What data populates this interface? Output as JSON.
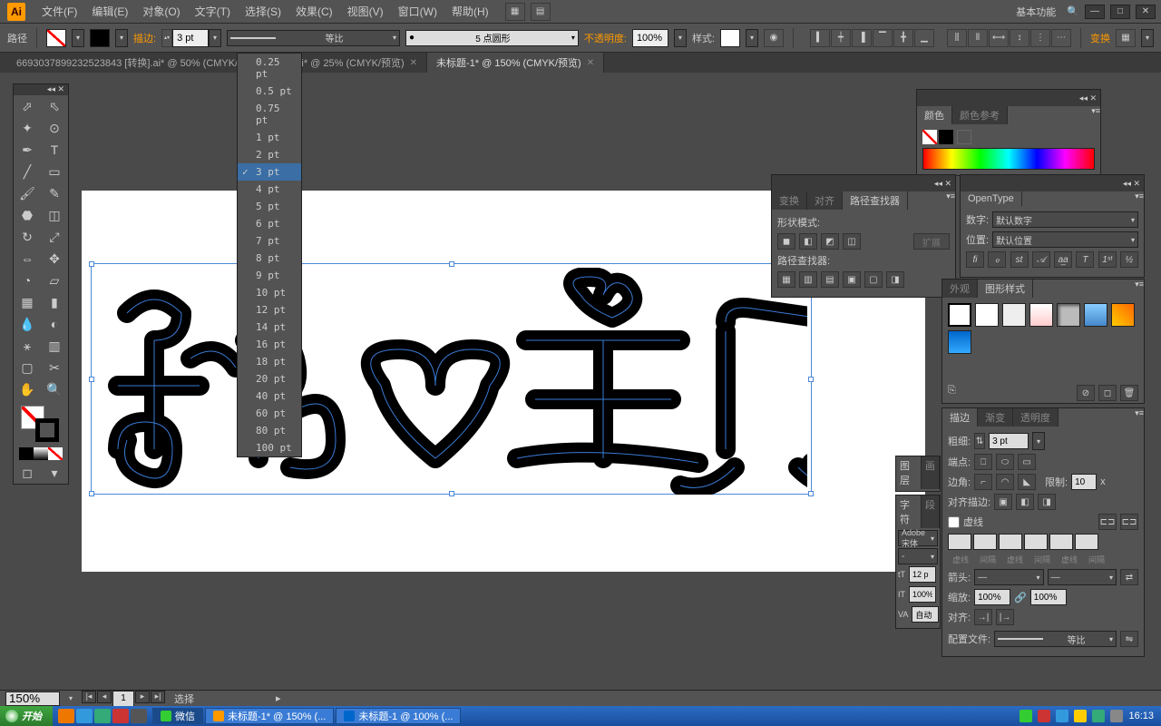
{
  "menubar": {
    "items": [
      "文件(F)",
      "编辑(E)",
      "对象(O)",
      "文字(T)",
      "选择(S)",
      "效果(C)",
      "视图(V)",
      "窗口(W)",
      "帮助(H)"
    ],
    "workspace": "基本功能"
  },
  "control": {
    "object_label": "路径",
    "stroke_label": "描边:",
    "stroke_value": "3 pt",
    "profile": "等比",
    "brush": "5 点圆形",
    "opacity_label": "不透明度:",
    "opacity_value": "100%",
    "style_label": "样式:",
    "transform_label": "变换"
  },
  "tabs": [
    {
      "label": "6693037899232523843 [转换].ai* @ 50% (CMYK/预览)",
      "active": false
    },
    {
      "label": ".ai* @ 25% (CMYK/预览)",
      "active": false
    },
    {
      "label": "未标题-1* @ 150% (CMYK/预览)",
      "active": true
    }
  ],
  "stroke_dropdown": {
    "items": [
      "0.25 pt",
      "0.5 pt",
      "0.75 pt",
      "1 pt",
      "2 pt",
      "3 pt",
      "4 pt",
      "5 pt",
      "6 pt",
      "7 pt",
      "8 pt",
      "9 pt",
      "10 pt",
      "12 pt",
      "14 pt",
      "16 pt",
      "18 pt",
      "20 pt",
      "40 pt",
      "60 pt",
      "80 pt",
      "100 pt"
    ],
    "selected": "3 pt"
  },
  "panels": {
    "color": {
      "tab1": "颜色",
      "tab2": "颜色参考"
    },
    "pathfinder": {
      "tab1": "变换",
      "tab2": "对齐",
      "tab3": "路径查找器",
      "shape_mode": "形状模式:",
      "pathfinder_lbl": "路径查找器:",
      "expand": "扩展"
    },
    "opentype": {
      "tab": "OpenType",
      "digit_lbl": "数字:",
      "digit_val": "默认数字",
      "pos_lbl": "位置:",
      "pos_val": "默认位置"
    },
    "appearance": {
      "tab1": "外观",
      "tab2": "图形样式"
    },
    "layers": {
      "tab1": "图层",
      "tab2": "画"
    },
    "char": {
      "tab1": "字符",
      "tab2": "段",
      "font": "Adobe 宋体",
      "size": "12 p",
      "leading": "100%",
      "tracking": "自动"
    },
    "stroke": {
      "tab1": "描边",
      "tab2": "渐变",
      "tab3": "透明度",
      "weight_lbl": "粗细:",
      "weight": "3 pt",
      "cap_lbl": "端点:",
      "corner_lbl": "边角:",
      "limit_lbl": "限制:",
      "limit": "10",
      "limit_x": "x",
      "align_lbl": "对齐描边:",
      "dashed": "虚线",
      "dash_hdr": [
        "虚线",
        "间隔",
        "虚线",
        "间隔",
        "虚线",
        "间隔"
      ],
      "arrow_lbl": "箭头:",
      "scale_lbl": "缩放:",
      "scale": "100%",
      "align2": "对齐:",
      "profile_lbl": "配置文件:",
      "profile": "等比"
    }
  },
  "status": {
    "zoom": "150%",
    "page": "1",
    "mode": "选择"
  },
  "taskbar": {
    "start": "开始",
    "tasks": [
      "微信",
      "未标题-1* @ 150% (...",
      "未标题-1 @ 100% (..."
    ],
    "time": "16:13"
  }
}
